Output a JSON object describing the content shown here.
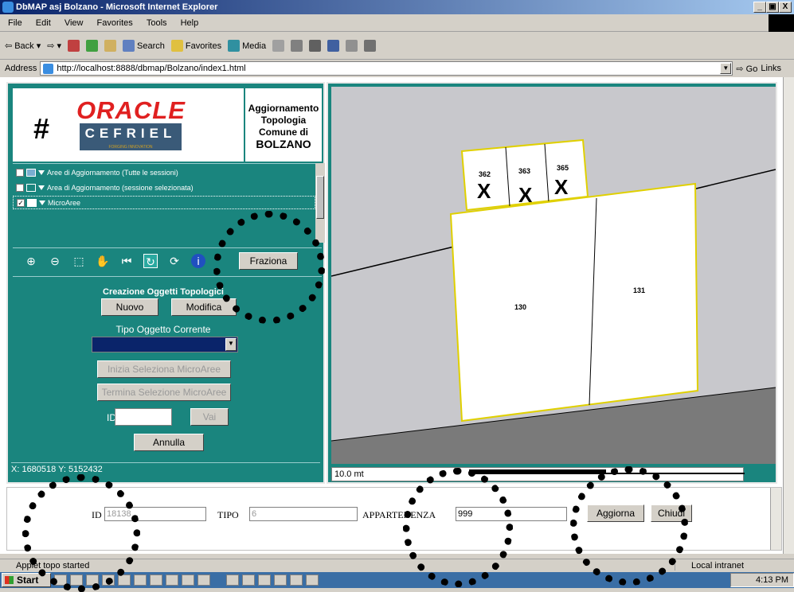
{
  "window": {
    "title": "DbMAP asj Bolzano - Microsoft Internet Explorer",
    "controls": [
      "_",
      "Ɖ",
      "X"
    ]
  },
  "menu": [
    "File",
    "Edit",
    "View",
    "Favorites",
    "Tools",
    "Help"
  ],
  "toolbar": {
    "back": "Back",
    "search": "Search",
    "favorites": "Favorites",
    "media": "Media"
  },
  "address": {
    "label": "Address",
    "url": "http://localhost:8888/dbmap/Bolzano/index1.html",
    "go": "Go",
    "links": "Links"
  },
  "logo": {
    "oracle": "ORACLE",
    "cefriel": "CEFRIEL",
    "tagline": "FORGING INNOVATION"
  },
  "panel_title": {
    "line1": "Aggiornamento",
    "line2": "Topologia",
    "line3": "Comune di",
    "line4": "BOLZANO"
  },
  "layers": [
    {
      "label": "Aree di Aggiornamento (Tutte le sessioni)",
      "checked": false,
      "color": "#7aaed0"
    },
    {
      "label": "Area di Aggiornamento (sessione selezionata)",
      "checked": false,
      "color": "#1a857e"
    },
    {
      "label": "MicroAree",
      "checked": true,
      "color": "#ffffff"
    }
  ],
  "tools": {
    "zoom_in": "zoom-in-icon",
    "zoom_out": "zoom-out-icon",
    "zoom_box": "zoom-box-icon",
    "pan": "pan-hand-icon",
    "full_extent": "full-extent-icon",
    "refresh": "refresh-icon",
    "select": "select-icon",
    "info": "info-icon",
    "fraziona": "Fraziona"
  },
  "creation": {
    "title": "Creazione Oggetti Topologici",
    "nuovo": "Nuovo",
    "modifica": "Modifica",
    "tipo_label": "Tipo Oggetto Corrente",
    "inizia": "Inizia Seleziona MicroAree",
    "termina": "Termina Selezione MicroAree",
    "id_label": "ID",
    "vai": "Vai",
    "annulla": "Annulla"
  },
  "coords": "X: 1680518 Y: 5152432",
  "map": {
    "parcels": [
      "362",
      "363",
      "365",
      "130",
      "131"
    ],
    "markers": [
      "X",
      "X",
      "X"
    ],
    "scale": "10.0 mt"
  },
  "form": {
    "id_label": "ID",
    "id_value": "18138",
    "tipo_label": "TIPO",
    "tipo_value": "6",
    "appartenenza_label": "APPARTENENZA",
    "appartenenza_value": "999",
    "aggiorna": "Aggiorna",
    "chiudi": "Chiudi"
  },
  "status": {
    "text": "Applet topo started",
    "zone": "Local intranet"
  },
  "taskbar": {
    "start": "Start",
    "clock": "4:13 PM"
  }
}
